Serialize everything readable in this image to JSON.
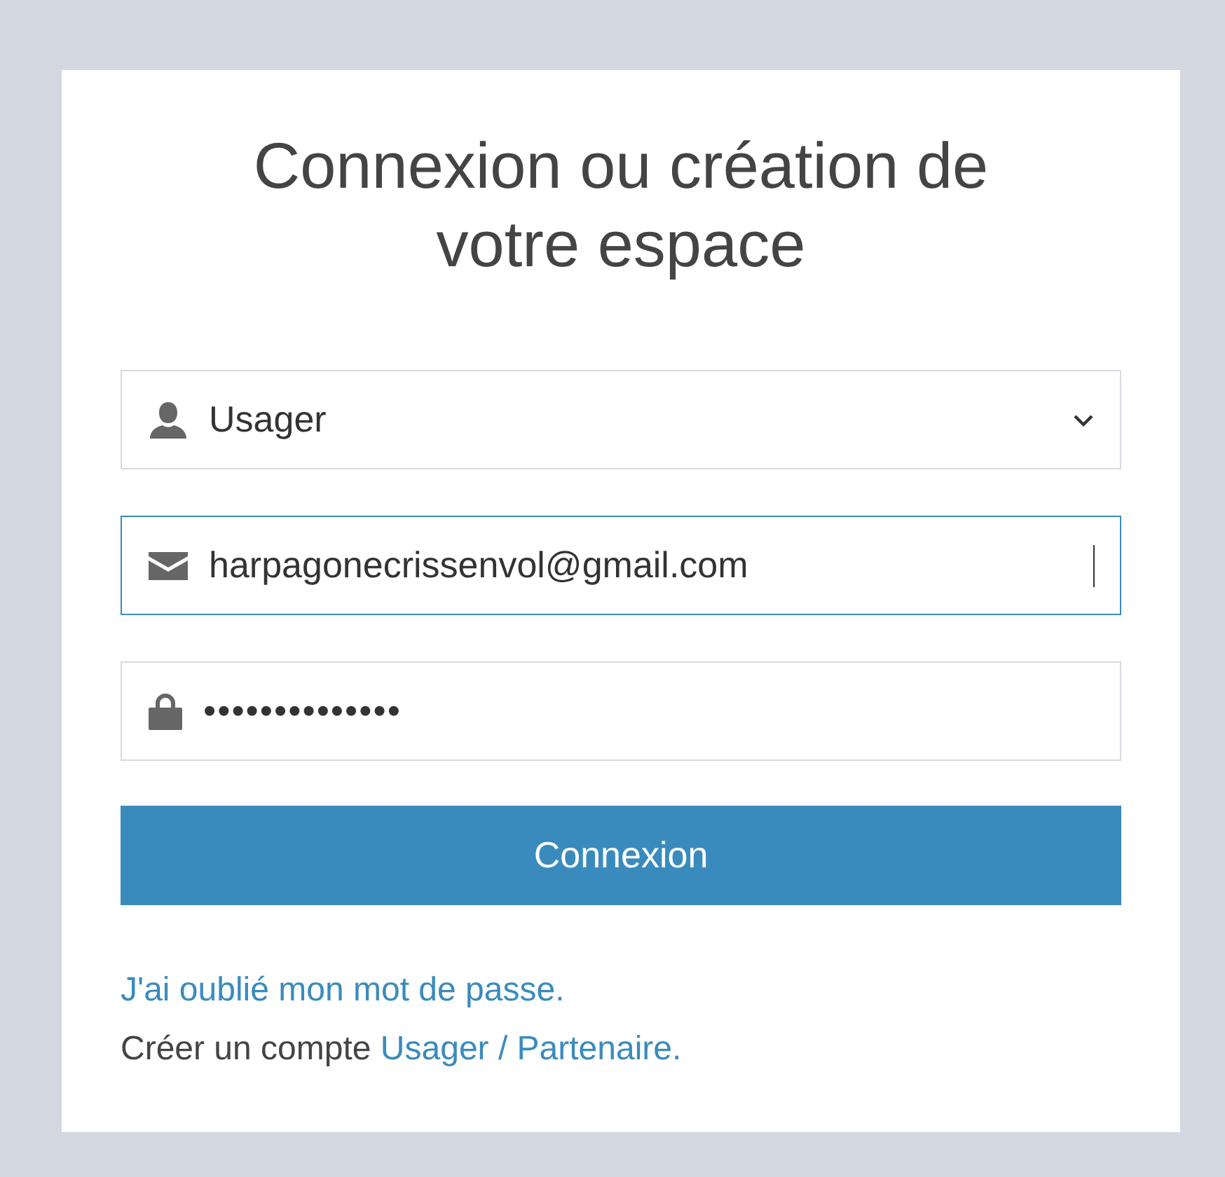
{
  "title": "Connexion ou création de votre espace",
  "fields": [
    {
      "kind": "select",
      "value": "Usager",
      "focused": false
    },
    {
      "kind": "email",
      "value": "harpagonecrissenvol@gmail.com",
      "focused": true
    },
    {
      "kind": "password",
      "value": "••••••••••••••",
      "focused": false
    }
  ],
  "submit": {
    "label": "Connexion"
  },
  "forgot_link": "J'ai oublié mon mot de passe.",
  "create_account": {
    "text": "Créer un compte",
    "link": "Usager / Partenaire."
  }
}
